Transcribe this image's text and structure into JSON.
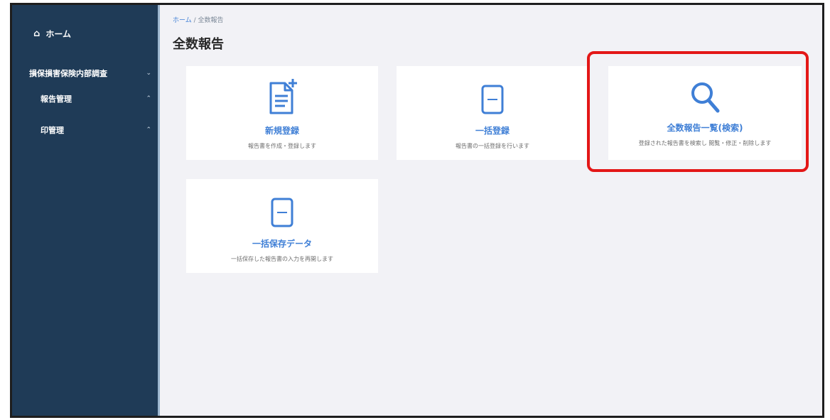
{
  "sidebar": {
    "home_label": "ホーム",
    "section_label": "損保損害保険内部調査",
    "sub_items": [
      {
        "label": "報告管理"
      },
      {
        "label": "印管理"
      }
    ]
  },
  "header": {
    "breadcrumb_home": "ホーム",
    "breadcrumb_sep": "/",
    "breadcrumb_current": "全数報告",
    "page_title": "全数報告"
  },
  "cards": [
    {
      "title": "新規登録",
      "description": "報告書を作成・登録します"
    },
    {
      "title": "一括登録",
      "description": "報告書の一括登録を行います"
    },
    {
      "title": "全数報告一覧(検索)",
      "description": "登録された報告書を検索し 閲覧・修正・削除します"
    },
    {
      "title": "一括保存データ",
      "description": "一括保存した報告書の入力を再開します"
    }
  ],
  "highlight_color": "#e31717",
  "accent_color": "#3f7fd6",
  "sidebar_color": "#1f3b57"
}
